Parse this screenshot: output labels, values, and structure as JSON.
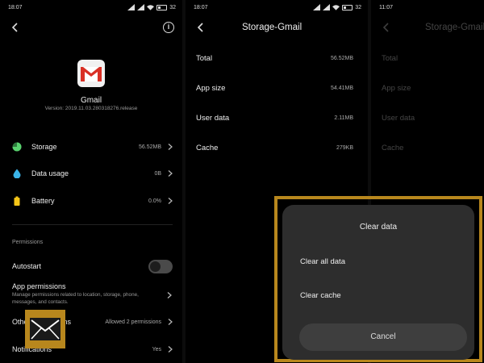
{
  "status": {
    "time_p1": "18:07",
    "time_p2": "18:07",
    "time_p3": "11:07",
    "battery_p1": "32",
    "battery_p2": "32"
  },
  "app_info": {
    "app_name": "Gmail",
    "version": "Version: 2019.11.03.280318276.release",
    "rows": [
      {
        "label": "Storage",
        "value": "56.52MB",
        "icon": "pie-chart-icon",
        "color": "#59d26f"
      },
      {
        "label": "Data usage",
        "value": "0B",
        "icon": "water-drop-icon",
        "color": "#3ab4e8"
      },
      {
        "label": "Battery",
        "value": "0.0%",
        "icon": "battery-icon",
        "color": "#f5c518"
      }
    ],
    "permissions_header": "Permissions",
    "autostart_label": "Autostart",
    "app_permissions_label": "App permissions",
    "app_permissions_desc": "Manage permissions related to location, storage, phone, messages, and contacts.",
    "other_permissions_label": "Other permissions",
    "other_permissions_value": "Allowed 2 permissions",
    "notifications_label": "Notifications",
    "notifications_value": "Yes"
  },
  "storage": {
    "title": "Storage-Gmail",
    "rows": [
      {
        "label": "Total",
        "value": "56.52MB"
      },
      {
        "label": "App size",
        "value": "54.41MB"
      },
      {
        "label": "User data",
        "value": "2.11MB"
      },
      {
        "label": "Cache",
        "value": "279KB"
      }
    ]
  },
  "dialog": {
    "title": "Clear data",
    "clear_all": "Clear all data",
    "clear_cache": "Clear cache",
    "cancel": "Cancel"
  },
  "colors": {
    "highlight_frame": "#b8871d",
    "gmail_red": "#d93025"
  }
}
